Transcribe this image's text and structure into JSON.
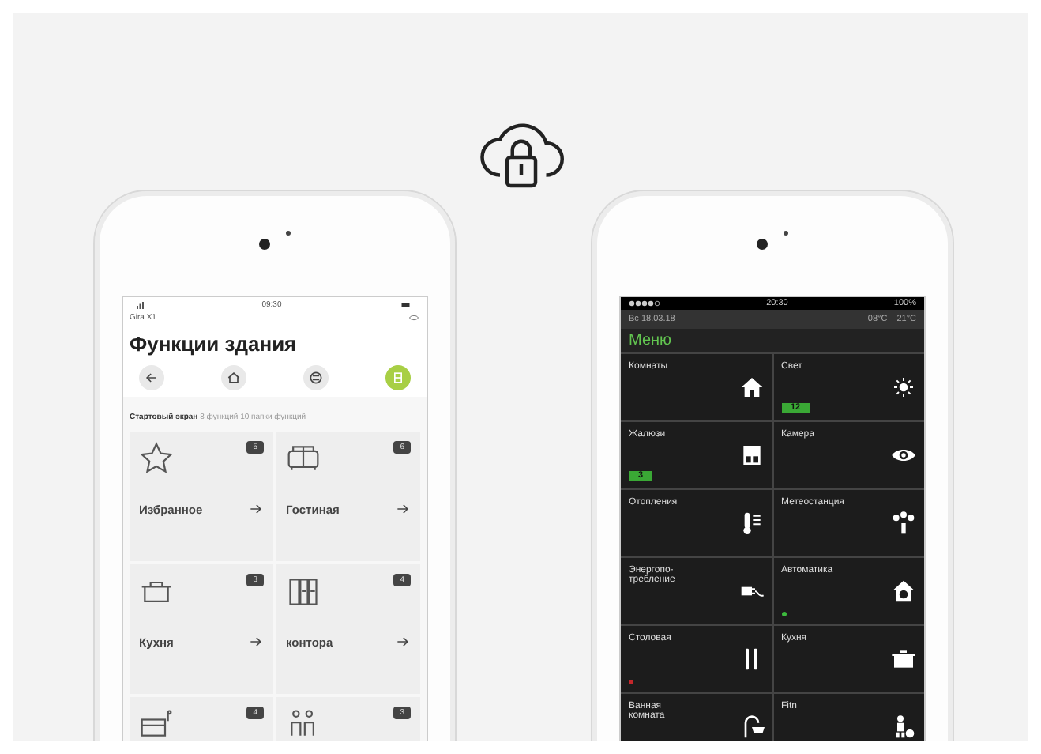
{
  "left_phone": {
    "status_time": "09:30",
    "app_name": "Gira X1",
    "title": "Функции здания",
    "subtitle": "**Стартовый экран** 8 функций 10 папки функций",
    "tiles": [
      {
        "label": "Избранное",
        "badge": "5"
      },
      {
        "label": "Гостиная",
        "badge": "6"
      },
      {
        "label": "Кухня",
        "badge": "3"
      },
      {
        "label": "контора",
        "badge": "4"
      },
      {
        "badge": "4"
      },
      {
        "badge": "3"
      }
    ]
  },
  "right_phone": {
    "status_time": "20:30",
    "battery": "100%",
    "date": "Вс 18.03.18",
    "outdoor_temp": "08°C",
    "indoor_temp": "21°C",
    "menu_title": "Меню",
    "tiles": [
      {
        "label": "Комнаты"
      },
      {
        "label": "Свет",
        "count": "12"
      },
      {
        "label": "Жалюзи",
        "count": "3"
      },
      {
        "label": "Камера"
      },
      {
        "label": "Отопления"
      },
      {
        "label": "Метеостанция"
      },
      {
        "label": "Энергопо-\nтребление"
      },
      {
        "label": "Автоматика",
        "color": "#3dbb3d"
      },
      {
        "label": "Столовая",
        "color": "#c4272b"
      },
      {
        "label": "Кухня"
      },
      {
        "label": "Ванная\nкомната"
      },
      {
        "label": "Fitn"
      }
    ]
  }
}
